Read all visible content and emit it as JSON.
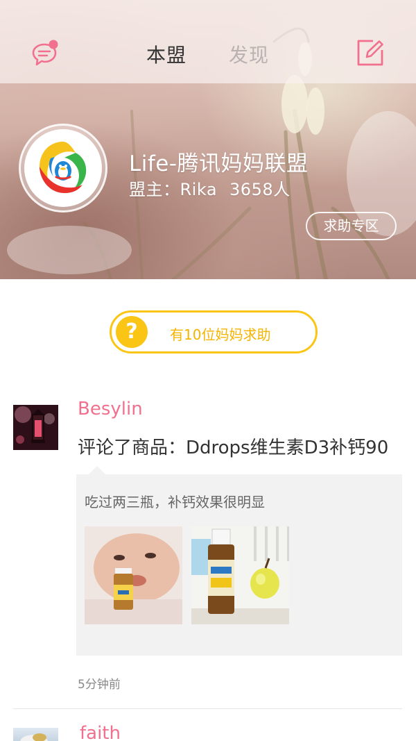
{
  "header": {
    "tabs": [
      {
        "label": "本盟",
        "active": true
      },
      {
        "label": "发现",
        "active": false
      }
    ],
    "icons": {
      "messages": "chat-bubble-icon",
      "compose": "edit-icon"
    },
    "accent_color": "#f0708e"
  },
  "group": {
    "title": "Life-腾讯妈妈联盟",
    "owner_label": "盟主：Rika",
    "member_count": "3658人",
    "help_zone_label": "求助专区"
  },
  "help_banner": {
    "icon_text": "?",
    "text": "有10位妈妈求助",
    "color": "#fbc515"
  },
  "feed": [
    {
      "username": "Besylin",
      "action": "评论了商品：Ddrops维生素D3补钙90",
      "comment": "吃过两三瓶，补钙效果很明显",
      "photos": [
        "baby-with-ddrops-bottle",
        "ddrops-bottle-with-apple"
      ],
      "time": "5分钟前"
    },
    {
      "username": "faith"
    }
  ]
}
